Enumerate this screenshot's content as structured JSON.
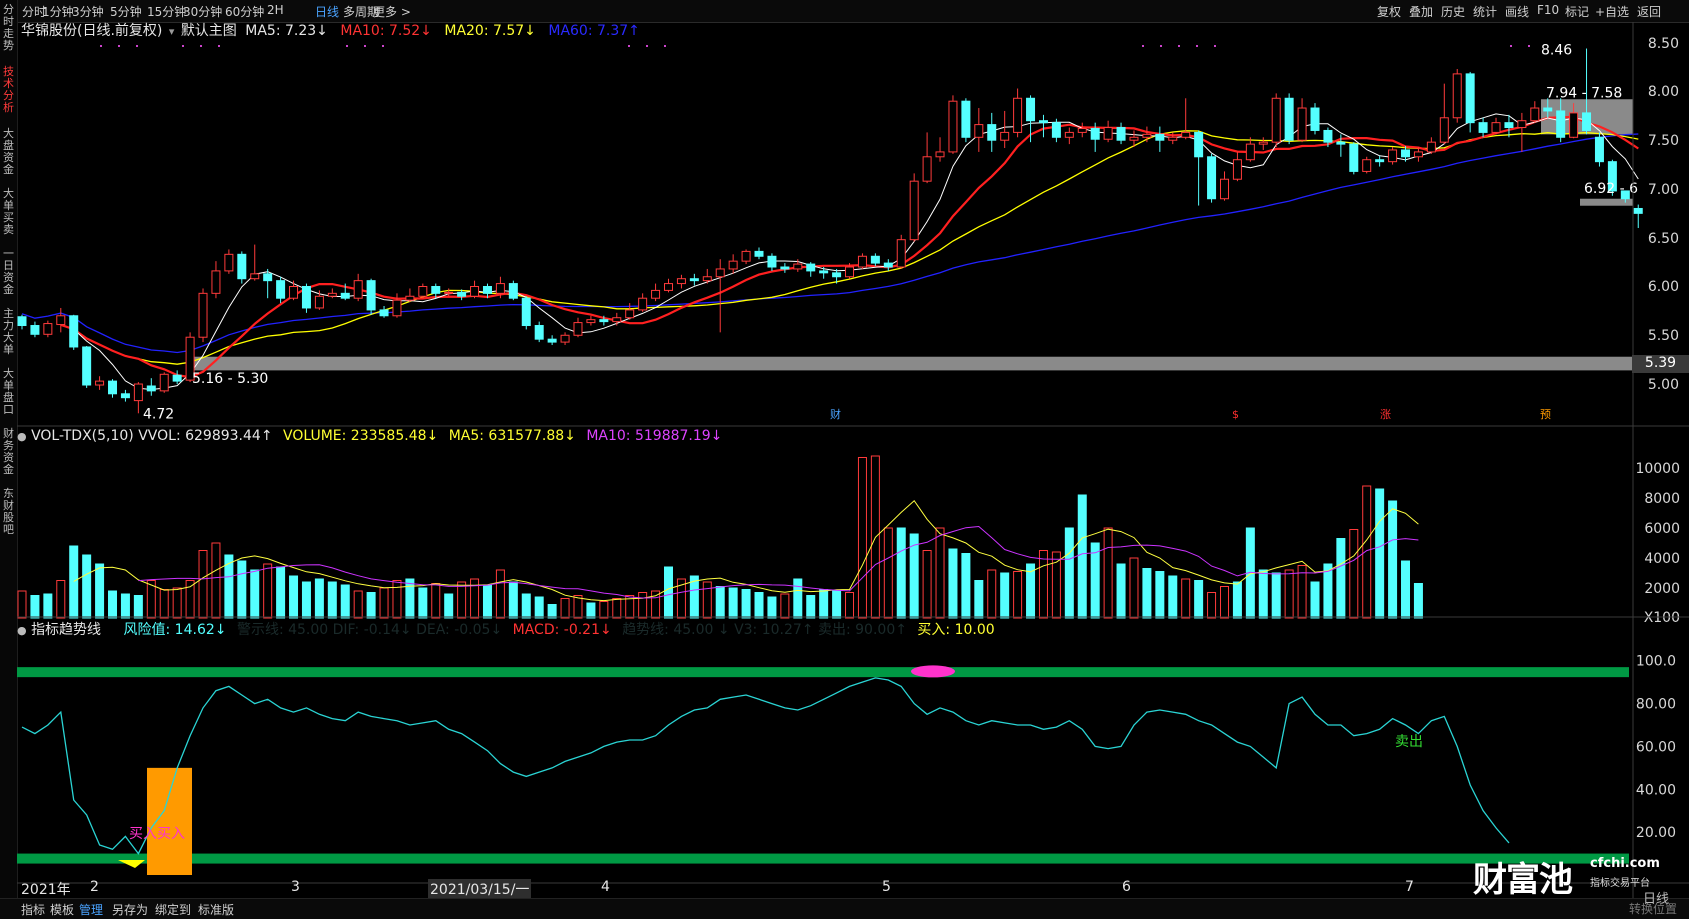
{
  "top_tabs": [
    {
      "label": "分时",
      "active": false
    },
    {
      "label": "1分钟",
      "active": false
    },
    {
      "label": "3分钟",
      "active": false
    },
    {
      "label": "5分钟",
      "active": false
    },
    {
      "label": "15分钟",
      "active": false
    },
    {
      "label": "30分钟",
      "active": false
    },
    {
      "label": "60分钟",
      "active": false
    },
    {
      "label": "2H",
      "active": false
    },
    {
      "label": "日线",
      "active": true
    },
    {
      "label": "多周期",
      "active": false
    },
    {
      "label": "更多 >",
      "active": false
    }
  ],
  "right_tools": [
    "复权",
    "叠加",
    "历史",
    "统计",
    "画线",
    "F10",
    "标记",
    "+自选",
    "返回"
  ],
  "left_tabs": [
    {
      "label": "分时走势",
      "active": false
    },
    {
      "label": "技术分析",
      "active": true
    },
    {
      "label": "大盘资金",
      "active": false
    },
    {
      "label": "大单买卖",
      "active": false
    },
    {
      "label": "一日资金",
      "active": false
    },
    {
      "label": "主力大单",
      "active": false
    },
    {
      "label": "大单盘口",
      "active": false
    },
    {
      "label": "财务资金",
      "active": false
    },
    {
      "label": "东财股吧",
      "active": false
    }
  ],
  "main_info": {
    "stock": "华锦股份(日线.前复权)",
    "template": "默认主图",
    "ma5": "MA5: 7.23↓",
    "ma10": "MA10: 7.52↓",
    "ma20": "MA20: 7.57↓",
    "ma60": "MA60: 7.37↑"
  },
  "price_axis": [
    "8.50",
    "8.00",
    "7.50",
    "7.00",
    "6.50",
    "6.00",
    "5.50",
    "5.00"
  ],
  "price_marker": "5.39",
  "annotations": {
    "high": "8.46",
    "low": "4.72",
    "range_upper": "7.94 - 7.58",
    "range_right": "6.92 - 6",
    "range_lower": "5.16 - 5.30"
  },
  "event_marks": [
    {
      "label": "财",
      "color": "#4aa3ff"
    },
    {
      "label": "$",
      "color": "#ff3030"
    },
    {
      "label": "涨",
      "color": "#ff3030"
    },
    {
      "label": "预",
      "color": "#ff9a00"
    }
  ],
  "vol_info": {
    "title": "VOL-TDX(5,10)",
    "vvol": "VVOL: 629893.44↑",
    "volume": "VOLUME: 233585.48↓",
    "ma5": "MA5: 631577.88↓",
    "ma10": "MA10: 519887.19↓"
  },
  "vol_axis": [
    "10000",
    "8000",
    "6000",
    "4000",
    "2000",
    "X100"
  ],
  "ind_info": {
    "title": "指标趋势线",
    "risk": "风险值: 14.62↓",
    "obscured": "警示线: 45.00 DIF: -0.14↓ DEA: -0.05↓",
    "macd": "MACD: -0.21↓",
    "obscured2": "趋势线: 45.00 ↓ V3: 10.27↑ 卖出: 90.00↑",
    "buy": "买入: 10.00"
  },
  "ind_axis": [
    "100.0",
    "80.00",
    "60.00",
    "40.00",
    "20.00"
  ],
  "ind_labels": {
    "buy": "买入买入",
    "sell": "卖出"
  },
  "date_axis": [
    {
      "label": "2021年"
    },
    {
      "label": "2"
    },
    {
      "label": "3"
    },
    {
      "label": "2021/03/15/一"
    },
    {
      "label": "4"
    },
    {
      "label": "5"
    },
    {
      "label": "6"
    },
    {
      "label": "7"
    }
  ],
  "bottom_tabs": [
    "指标",
    "模板",
    "管理",
    "另存为",
    "绑定到",
    "标准版"
  ],
  "watermark": {
    "logo": "财富池",
    "url": "cfchi.com",
    "sub": "指标交易平台",
    "partial": "日线",
    "partial2": "转换位置"
  },
  "colors": {
    "up": "#ff3b3b",
    "down": "#54ffff",
    "ma5": "#ffffff",
    "ma10": "#ff2020",
    "ma20": "#ffff00",
    "ma60": "#2222ff",
    "band": "#009944",
    "vol_ma5": "#ffff40",
    "vol_ma10": "#cc33ff"
  },
  "chart_data": {
    "type": "candlestick",
    "candles": [
      [
        5.71,
        5.62,
        5.73,
        5.58
      ],
      [
        5.62,
        5.53,
        5.66,
        5.5
      ],
      [
        5.53,
        5.64,
        5.67,
        5.5
      ],
      [
        5.63,
        5.72,
        5.8,
        5.55
      ],
      [
        5.72,
        5.4,
        5.73,
        5.37
      ],
      [
        5.4,
        5.01,
        5.41,
        4.98
      ],
      [
        5.01,
        5.05,
        5.1,
        4.96
      ],
      [
        5.05,
        4.92,
        5.07,
        4.88
      ],
      [
        4.92,
        4.88,
        4.96,
        4.84
      ],
      [
        4.85,
        5.02,
        5.04,
        4.72
      ],
      [
        5.0,
        4.95,
        5.08,
        4.9
      ],
      [
        4.95,
        5.12,
        5.14,
        4.93
      ],
      [
        5.11,
        5.05,
        5.16,
        5.02
      ],
      [
        5.06,
        5.5,
        5.55,
        5.04
      ],
      [
        5.5,
        5.95,
        6.0,
        5.45
      ],
      [
        5.95,
        6.18,
        6.28,
        5.9
      ],
      [
        6.18,
        6.35,
        6.4,
        6.15
      ],
      [
        6.35,
        6.1,
        6.38,
        6.05
      ],
      [
        6.1,
        6.15,
        6.45,
        6.08
      ],
      [
        6.15,
        6.08,
        6.2,
        5.9
      ],
      [
        6.08,
        5.9,
        6.12,
        5.85
      ],
      [
        5.9,
        6.02,
        6.08,
        5.88
      ],
      [
        6.02,
        5.8,
        6.05,
        5.75
      ],
      [
        5.8,
        5.92,
        5.98,
        5.78
      ],
      [
        5.92,
        5.95,
        6.0,
        5.9
      ],
      [
        5.95,
        5.9,
        6.05,
        5.88
      ],
      [
        5.9,
        6.08,
        6.15,
        5.87
      ],
      [
        6.08,
        5.78,
        6.1,
        5.73
      ],
      [
        5.78,
        5.72,
        5.82,
        5.7
      ],
      [
        5.72,
        5.88,
        5.95,
        5.7
      ],
      [
        5.88,
        5.92,
        6.0,
        5.86
      ],
      [
        5.92,
        6.02,
        6.05,
        5.9
      ],
      [
        6.02,
        5.95,
        6.05,
        5.9
      ],
      [
        5.95,
        5.96,
        6.0,
        5.92
      ],
      [
        5.96,
        5.92,
        5.99,
        5.88
      ],
      [
        5.92,
        6.02,
        6.08,
        5.9
      ],
      [
        6.02,
        5.95,
        6.05,
        5.9
      ],
      [
        5.95,
        6.05,
        6.12,
        5.9
      ],
      [
        6.05,
        5.9,
        6.08,
        5.88
      ],
      [
        5.9,
        5.62,
        5.92,
        5.58
      ],
      [
        5.62,
        5.48,
        5.66,
        5.45
      ],
      [
        5.48,
        5.45,
        5.52,
        5.42
      ],
      [
        5.45,
        5.52,
        5.55,
        5.42
      ],
      [
        5.52,
        5.65,
        5.7,
        5.5
      ],
      [
        5.65,
        5.68,
        5.72,
        5.62
      ],
      [
        5.68,
        5.66,
        5.72,
        5.62
      ],
      [
        5.66,
        5.7,
        5.75,
        5.62
      ],
      [
        5.7,
        5.78,
        5.85,
        5.68
      ],
      [
        5.78,
        5.9,
        5.95,
        5.76
      ],
      [
        5.9,
        5.98,
        6.05,
        5.87
      ],
      [
        5.98,
        6.05,
        6.1,
        5.96
      ],
      [
        6.05,
        6.1,
        6.14,
        6.0
      ],
      [
        6.1,
        6.08,
        6.15,
        6.03
      ],
      [
        6.08,
        6.12,
        6.2,
        6.05
      ],
      [
        6.12,
        6.2,
        6.3,
        5.55
      ],
      [
        6.2,
        6.28,
        6.35,
        6.15
      ],
      [
        6.28,
        6.38,
        6.4,
        6.25
      ],
      [
        6.38,
        6.33,
        6.42,
        6.3
      ],
      [
        6.33,
        6.22,
        6.36,
        6.18
      ],
      [
        6.22,
        6.2,
        6.26,
        6.16
      ],
      [
        6.2,
        6.25,
        6.3,
        6.17
      ],
      [
        6.25,
        6.18,
        6.27,
        6.12
      ],
      [
        6.18,
        6.16,
        6.22,
        6.1
      ],
      [
        6.16,
        6.12,
        6.2,
        6.05
      ],
      [
        6.12,
        6.22,
        6.26,
        6.1
      ],
      [
        6.22,
        6.33,
        6.36,
        6.2
      ],
      [
        6.33,
        6.26,
        6.36,
        6.23
      ],
      [
        6.26,
        6.22,
        6.3,
        6.18
      ],
      [
        6.22,
        6.5,
        6.55,
        6.2
      ],
      [
        6.5,
        7.1,
        7.18,
        6.48
      ],
      [
        7.1,
        7.35,
        7.6,
        7.08
      ],
      [
        7.35,
        7.4,
        7.55,
        7.3
      ],
      [
        7.4,
        7.92,
        7.98,
        7.38
      ],
      [
        7.92,
        7.55,
        7.95,
        7.5
      ],
      [
        7.55,
        7.68,
        7.85,
        7.4
      ],
      [
        7.68,
        7.52,
        7.8,
        7.4
      ],
      [
        7.52,
        7.6,
        7.82,
        7.44
      ],
      [
        7.6,
        7.95,
        8.05,
        7.55
      ],
      [
        7.95,
        7.72,
        7.98,
        7.5
      ],
      [
        7.72,
        7.7,
        7.78,
        7.55
      ],
      [
        7.7,
        7.55,
        7.74,
        7.5
      ],
      [
        7.55,
        7.6,
        7.65,
        7.48
      ],
      [
        7.6,
        7.64,
        7.7,
        7.55
      ],
      [
        7.64,
        7.53,
        7.7,
        7.4
      ],
      [
        7.53,
        7.65,
        7.72,
        7.5
      ],
      [
        7.65,
        7.52,
        7.7,
        7.48
      ],
      [
        7.52,
        7.55,
        7.62,
        7.45
      ],
      [
        7.55,
        7.58,
        7.66,
        7.5
      ],
      [
        7.58,
        7.52,
        7.66,
        7.4
      ],
      [
        7.52,
        7.55,
        7.6,
        7.48
      ],
      [
        7.55,
        7.6,
        7.95,
        7.53
      ],
      [
        7.6,
        7.35,
        7.62,
        6.85
      ],
      [
        7.35,
        6.92,
        7.38,
        6.88
      ],
      [
        6.92,
        7.12,
        7.2,
        6.9
      ],
      [
        7.12,
        7.32,
        7.4,
        7.1
      ],
      [
        7.32,
        7.48,
        7.55,
        7.3
      ],
      [
        7.48,
        7.5,
        7.55,
        7.42
      ],
      [
        7.5,
        7.95,
        8.0,
        7.45
      ],
      [
        7.95,
        7.52,
        8.0,
        7.48
      ],
      [
        7.52,
        7.85,
        7.95,
        7.5
      ],
      [
        7.85,
        7.62,
        7.9,
        7.58
      ],
      [
        7.62,
        7.5,
        7.65,
        7.45
      ],
      [
        7.5,
        7.48,
        7.58,
        7.35
      ],
      [
        7.48,
        7.2,
        7.5,
        7.17
      ],
      [
        7.2,
        7.32,
        7.35,
        7.18
      ],
      [
        7.32,
        7.3,
        7.36,
        7.25
      ],
      [
        7.3,
        7.42,
        7.45,
        7.27
      ],
      [
        7.42,
        7.35,
        7.46,
        7.3
      ],
      [
        7.35,
        7.4,
        7.45,
        7.3
      ],
      [
        7.4,
        7.5,
        7.55,
        7.38
      ],
      [
        7.5,
        7.75,
        8.1,
        7.48
      ],
      [
        7.75,
        8.2,
        8.25,
        7.7
      ],
      [
        8.2,
        7.7,
        8.22,
        7.6
      ],
      [
        7.7,
        7.6,
        7.75,
        7.55
      ],
      [
        7.6,
        7.7,
        7.75,
        7.58
      ],
      [
        7.7,
        7.65,
        7.78,
        7.55
      ],
      [
        7.65,
        7.72,
        7.8,
        7.4
      ],
      [
        7.72,
        7.85,
        7.92,
        7.7
      ],
      [
        7.85,
        7.82,
        7.95,
        7.75
      ],
      [
        7.82,
        7.55,
        7.95,
        7.5
      ],
      [
        7.55,
        7.8,
        7.9,
        7.54
      ],
      [
        7.8,
        7.62,
        8.46,
        7.58
      ],
      [
        7.55,
        7.3,
        7.6,
        7.25
      ],
      [
        7.3,
        7.0,
        7.32,
        6.95
      ],
      [
        7.0,
        6.92,
        7.0,
        6.88
      ],
      [
        6.82,
        6.77,
        6.86,
        6.62
      ]
    ],
    "volume": [
      [
        1800,
        "up"
      ],
      [
        1500,
        "down"
      ],
      [
        1600,
        "down"
      ],
      [
        2500,
        "up"
      ],
      [
        4800,
        "down"
      ],
      [
        4200,
        "down"
      ],
      [
        3600,
        "down"
      ],
      [
        1800,
        "down"
      ],
      [
        1600,
        "down"
      ],
      [
        1500,
        "down"
      ],
      [
        2500,
        "up"
      ],
      [
        1900,
        "up"
      ],
      [
        2000,
        "up"
      ],
      [
        2500,
        "up"
      ],
      [
        4500,
        "up"
      ],
      [
        5000,
        "up"
      ],
      [
        4200,
        "down"
      ],
      [
        3800,
        "down"
      ],
      [
        3200,
        "down"
      ],
      [
        3600,
        "up"
      ],
      [
        3400,
        "down"
      ],
      [
        2800,
        "down"
      ],
      [
        2400,
        "down"
      ],
      [
        2600,
        "down"
      ],
      [
        2400,
        "down"
      ],
      [
        2200,
        "down"
      ],
      [
        1800,
        "up"
      ],
      [
        1700,
        "down"
      ],
      [
        2000,
        "up"
      ],
      [
        2500,
        "up"
      ],
      [
        2600,
        "down"
      ],
      [
        2000,
        "down"
      ],
      [
        2300,
        "up"
      ],
      [
        1600,
        "down"
      ],
      [
        2400,
        "up"
      ],
      [
        2600,
        "up"
      ],
      [
        2200,
        "down"
      ],
      [
        3200,
        "up"
      ],
      [
        2400,
        "down"
      ],
      [
        1600,
        "down"
      ],
      [
        1400,
        "down"
      ],
      [
        900,
        "down"
      ],
      [
        1300,
        "up"
      ],
      [
        1500,
        "up"
      ],
      [
        1000,
        "down"
      ],
      [
        1100,
        "up"
      ],
      [
        1300,
        "up"
      ],
      [
        1500,
        "up"
      ],
      [
        1700,
        "up"
      ],
      [
        1800,
        "up"
      ],
      [
        3400,
        "down"
      ],
      [
        2600,
        "up"
      ],
      [
        2800,
        "down"
      ],
      [
        2400,
        "up"
      ],
      [
        2100,
        "down"
      ],
      [
        2000,
        "down"
      ],
      [
        1900,
        "down"
      ],
      [
        1700,
        "down"
      ],
      [
        1400,
        "down"
      ],
      [
        1600,
        "up"
      ],
      [
        2600,
        "down"
      ],
      [
        1500,
        "down"
      ],
      [
        1900,
        "down"
      ],
      [
        1800,
        "down"
      ],
      [
        1700,
        "up"
      ],
      [
        10700,
        "up"
      ],
      [
        10800,
        "up"
      ],
      [
        6000,
        "up"
      ],
      [
        6000,
        "down"
      ],
      [
        5600,
        "down"
      ],
      [
        4500,
        "up"
      ],
      [
        6000,
        "up"
      ],
      [
        4600,
        "down"
      ],
      [
        4300,
        "down"
      ],
      [
        2500,
        "down"
      ],
      [
        3200,
        "up"
      ],
      [
        3000,
        "down"
      ],
      [
        3100,
        "up"
      ],
      [
        3600,
        "down"
      ],
      [
        4500,
        "up"
      ],
      [
        4400,
        "up"
      ],
      [
        6000,
        "down"
      ],
      [
        8200,
        "down"
      ],
      [
        5000,
        "down"
      ],
      [
        6000,
        "up"
      ],
      [
        3600,
        "down"
      ],
      [
        4000,
        "up"
      ],
      [
        3300,
        "down"
      ],
      [
        3100,
        "down"
      ],
      [
        2800,
        "down"
      ],
      [
        2600,
        "up"
      ],
      [
        2500,
        "down"
      ],
      [
        1700,
        "up"
      ],
      [
        2100,
        "up"
      ],
      [
        2400,
        "down"
      ],
      [
        6000,
        "down"
      ],
      [
        3200,
        "down"
      ],
      [
        3000,
        "down"
      ],
      [
        3200,
        "up"
      ],
      [
        3500,
        "up"
      ],
      [
        2400,
        "down"
      ],
      [
        3600,
        "down"
      ],
      [
        5300,
        "down"
      ],
      [
        5900,
        "up"
      ],
      [
        8800,
        "up"
      ],
      [
        8600,
        "down"
      ],
      [
        7800,
        "down"
      ],
      [
        3800,
        "down"
      ],
      [
        2300,
        "down"
      ]
    ],
    "indicator": [
      69,
      66,
      70,
      76,
      35,
      28,
      14,
      12,
      18,
      10,
      22,
      30,
      50,
      65,
      78,
      86,
      88,
      84,
      80,
      82,
      78,
      76,
      78,
      75,
      73,
      72,
      76,
      74,
      73,
      72,
      70,
      71,
      72,
      68,
      66,
      62,
      58,
      52,
      48,
      46,
      48,
      50,
      53,
      55,
      57,
      60,
      62,
      63,
      63,
      65,
      70,
      74,
      77,
      78,
      82,
      83,
      84,
      82,
      80,
      78,
      77,
      79,
      82,
      85,
      88,
      90,
      92,
      91,
      88,
      80,
      75,
      78,
      76,
      72,
      70,
      72,
      71,
      70,
      70,
      68,
      69,
      72,
      68,
      60,
      59,
      60,
      70,
      76,
      77,
      76,
      75,
      72,
      70,
      66,
      62,
      60,
      55,
      50,
      80,
      83,
      75,
      70,
      70,
      65,
      66,
      68,
      73,
      70,
      66,
      72,
      74,
      60,
      42,
      30,
      22,
      15
    ],
    "ylim_price": [
      4.6,
      8.65
    ],
    "ylim_volume": [
      0,
      11000
    ],
    "ylim_indicator": [
      0,
      105
    ]
  }
}
